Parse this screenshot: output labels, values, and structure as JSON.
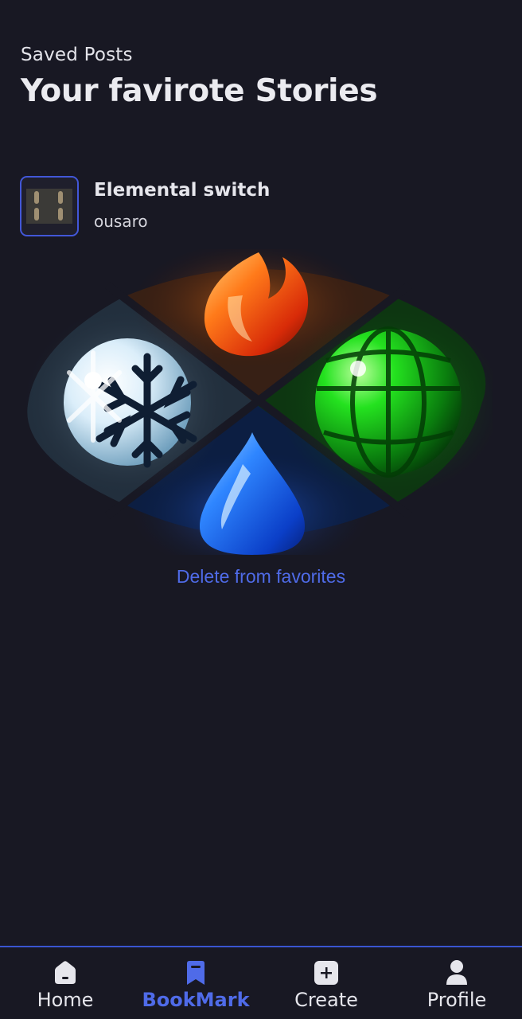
{
  "header": {
    "eyebrow": "Saved Posts",
    "title": "Your favirote Stories"
  },
  "post": {
    "title": "Elemental switch",
    "author": "ousaro",
    "thumbnail_icon": "game-thumbnail",
    "cover_icon": "four-elements-art"
  },
  "actions": {
    "delete_label": "Delete from favorites"
  },
  "nav": {
    "items": [
      {
        "label": "Home",
        "icon": "home-icon",
        "active": false
      },
      {
        "label": "BookMark",
        "icon": "bookmark-icon",
        "active": true
      },
      {
        "label": "Create",
        "icon": "plus-square-icon",
        "active": false
      },
      {
        "label": "Profile",
        "icon": "user-icon",
        "active": false
      }
    ]
  },
  "colors": {
    "background": "#181823",
    "accent": "#4f6be8",
    "text": "#e6e6ec"
  }
}
